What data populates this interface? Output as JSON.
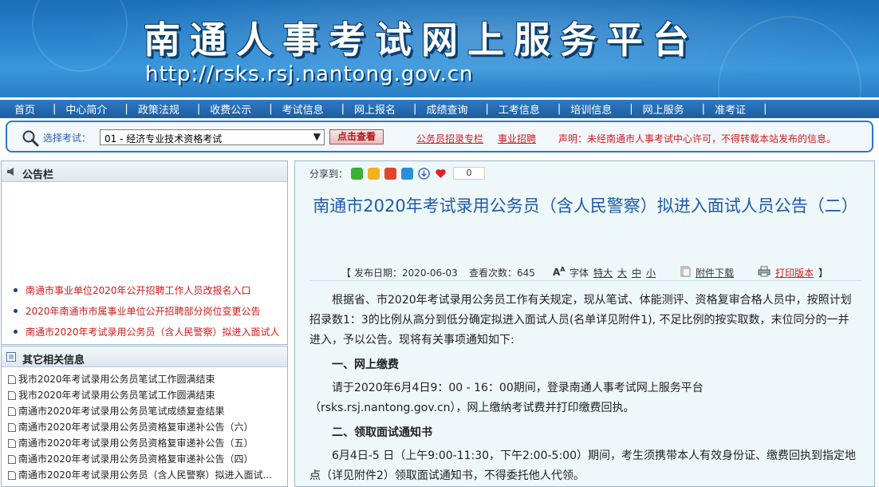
{
  "banner": {
    "title": "南通人事考试网上服务平台",
    "url": "http://rsks.rsj.nantong.gov.cn"
  },
  "nav": {
    "items": [
      "首页",
      "中心简介",
      "政策法规",
      "收费公示",
      "考试信息",
      "网上报名",
      "成绩查询",
      "工考信息",
      "培训信息",
      "网上服务",
      "准考证"
    ],
    "separator": "|"
  },
  "search": {
    "label": "选择考试：",
    "selected": "01 - 经济专业技术资格考试",
    "button": "点击查看",
    "link1": "公务员招录专栏",
    "link2": "事业招聘",
    "notice": "声明：未经南通市人事考试中心许可，不得转载本站发布的信息。"
  },
  "announce": {
    "title": "公告栏",
    "items": [
      "南通市事业单位2020年公开招聘工作人员改报名入口",
      "2020年南通市市属事业单位公开招聘部分岗位变更公告",
      "南通市2020年考试录用公务员（含人民警察）拟进入面试人"
    ]
  },
  "related": {
    "title": "其它相关信息",
    "items": [
      "我市2020年考试录用公务员笔试工作圆满结束",
      "我市2020年考试录用公务员笔试工作圆满结束",
      "南通市2020年考试录用公务员笔试成绩复查结果",
      "南通市2020年考试录用公务员资格复审递补公告（六）",
      "南通市2020年考试录用公务员资格复审递补公告（五）",
      "南通市2020年考试录用公务员资格复审递补公告（四）",
      "南通市2020年考试录用公务员（含人民警察）拟进入面试..."
    ]
  },
  "share": {
    "label": "分享到：",
    "count": "0"
  },
  "article": {
    "title": "南通市2020年考试录用公务员（含人民警察）拟进入面试人员公告（二）",
    "meta": {
      "bracket_open": "【",
      "date": "发布日期：2020-06-03",
      "views": "查看次数：645",
      "font_label": "字体",
      "font_xl": "特大",
      "font_l": "大",
      "font_m": "中",
      "font_s": "小",
      "attach": "附件下载",
      "print": "打印版本",
      "bracket_close": "】"
    },
    "intro": "根据省、市2020年考试录用公务员工作有关规定，现从笔试、体能测评、资格复审合格人员中，按照计划招录数1：3的比例从高分到低分确定拟进入面试人员(名单详见附件1), 不足比例的按实取数，末位同分的一并进入，予以公告。现将有关事项通知如下:",
    "sec1_title": "一、网上缴费",
    "sec1_body": "请于2020年6月4日9：00 - 16：00期间，登录南通人事考试网上服务平台（rsks.rsj.nantong.gov.cn），网上缴纳考试费并打印缴费回执。",
    "sec2_title": "二、领取面试通知书",
    "sec2_body": "6月4日-5 日（上午9:00-11:30，下午2:00-5:00）期间，考生须携带本人有效身份证、缴费回执到指定地点（详见附件2）领取面试通知书，不得委托他人代领。"
  },
  "colors": {
    "nav_bg": "#1c5d9f",
    "title_blue": "#1f5aa8",
    "link_red": "#d41a1a",
    "panel_bg": "#eef8fa"
  }
}
